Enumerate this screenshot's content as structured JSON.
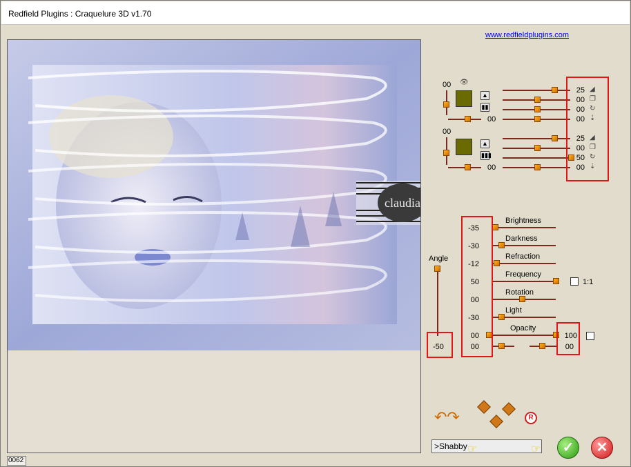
{
  "window": {
    "title": "Redfield Plugins : Craquelure 3D  v1.70",
    "url": "www.redfieldplugins.com"
  },
  "status": {
    "code": "0062"
  },
  "preview": {
    "watermark": "claudia"
  },
  "layers": [
    {
      "left_value": "00",
      "bottom_value": "00",
      "values": [
        "25",
        "00",
        "00",
        "00"
      ]
    },
    {
      "left_value": "00",
      "bottom_value": "00",
      "values": [
        "25",
        "00",
        "50",
        "00"
      ]
    }
  ],
  "params": {
    "angle": {
      "label": "Angle",
      "value": "-50"
    },
    "rows": [
      {
        "label": "Brightness",
        "value": "-35"
      },
      {
        "label": "Darkness",
        "value": "-30"
      },
      {
        "label": "Refraction",
        "value": "-12"
      },
      {
        "label": "Frequency",
        "value": "50",
        "extra": "1:1"
      },
      {
        "label": "Rotation",
        "value": "00"
      },
      {
        "label": "Light",
        "value": "-30"
      },
      {
        "label": "Opacity",
        "value": "00",
        "right_value": "100"
      },
      {
        "label": "",
        "value": "00",
        "right_value": "00"
      }
    ]
  },
  "preset": {
    "name": ">Shabby"
  },
  "buttons": {
    "random": "R"
  },
  "colors": {
    "highlight": "#e51515",
    "accent": "#f0a020"
  }
}
